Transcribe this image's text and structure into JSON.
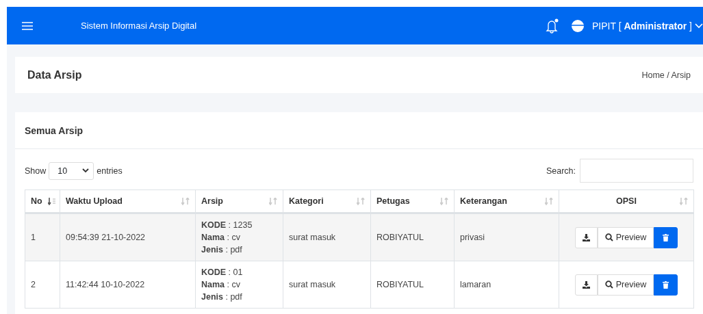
{
  "navbar": {
    "title": "Sistem Informasi Arsip Digital",
    "notification_dot": true,
    "user": "PIPIT [",
    "role": "Administrator",
    "role_close": "]"
  },
  "page_header": {
    "title": "Data Arsip",
    "breadcrumb": [
      "Home",
      "/",
      "Arsip"
    ]
  },
  "card": {
    "title": "Semua Arsip",
    "length": {
      "before": "Show",
      "value": "10",
      "after": "entries"
    },
    "search": {
      "label": "Search:"
    },
    "columns": [
      {
        "label": "No",
        "sorted": true
      },
      {
        "label": "Waktu Upload",
        "sorted": false
      },
      {
        "label": "Arsip",
        "sorted": false
      },
      {
        "label": "Kategori",
        "sorted": false
      },
      {
        "label": "Petugas",
        "sorted": false
      },
      {
        "label": "Keterangan",
        "sorted": false
      },
      {
        "label": "OPSI",
        "sorted": false
      }
    ],
    "rows": [
      {
        "no": "1",
        "waktu": "09:54:39 21-10-2022",
        "arsip": [
          "**KODE** : 1235",
          "**Nama** : cv",
          "**Jenis** : pdf"
        ],
        "kategori": "surat masuk",
        "petugas": "ROBIYATUL",
        "keterangan": "privasi",
        "preview": "Preview"
      },
      {
        "no": "2",
        "waktu": "11:42:44 10-10-2022",
        "arsip": [
          "**KODE** : 01",
          "**Nama** : cv",
          "**Jenis** : pdf"
        ],
        "kategori": "surat masuk",
        "petugas": "ROBIYATUL",
        "keterangan": "lamaran",
        "preview": "Preview"
      }
    ]
  }
}
